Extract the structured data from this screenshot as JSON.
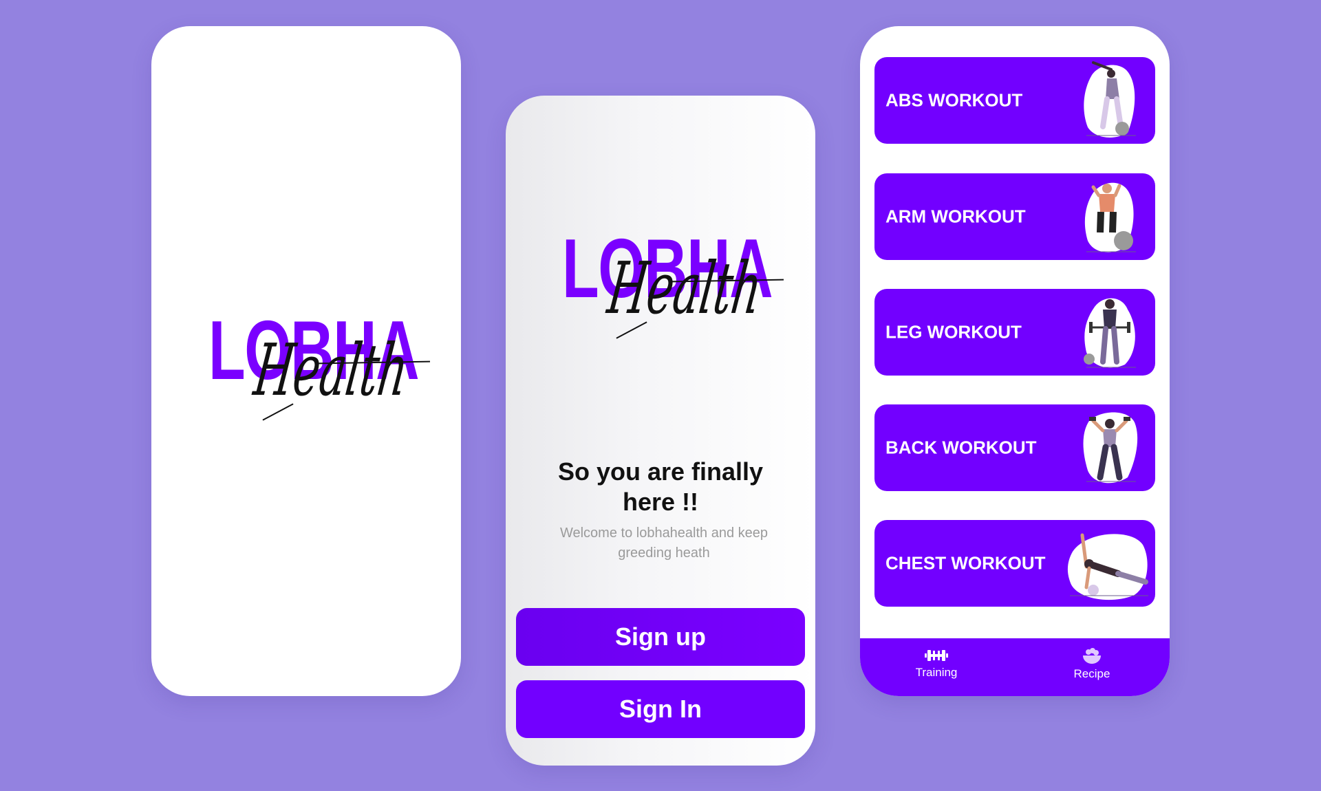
{
  "brand": {
    "name": "LOBHA",
    "script": "Health"
  },
  "welcome": {
    "title": "So you are finally here !!",
    "subtitle": "Welcome to lobhahealth and keep greeding heath",
    "signup_label": "Sign up",
    "signin_label": "Sign In"
  },
  "workouts": [
    {
      "label": "ABS WORKOUT",
      "icon": "abs-illustration"
    },
    {
      "label": "ARM WORKOUT",
      "icon": "arm-illustration"
    },
    {
      "label": "LEG WORKOUT",
      "icon": "leg-illustration"
    },
    {
      "label": "BACK WORKOUT",
      "icon": "back-illustration"
    },
    {
      "label": "CHEST WORKOUT",
      "icon": "chest-illustration"
    }
  ],
  "nav": [
    {
      "label": "Training",
      "icon": "dumbbell-icon"
    },
    {
      "label": "Recipe",
      "icon": "bowl-icon"
    }
  ],
  "colors": {
    "background": "#9382e0",
    "brand_purple": "#7200ff",
    "logo_purple": "#7a00ff",
    "text_dark": "#111111",
    "text_muted": "#9a9a9a"
  }
}
